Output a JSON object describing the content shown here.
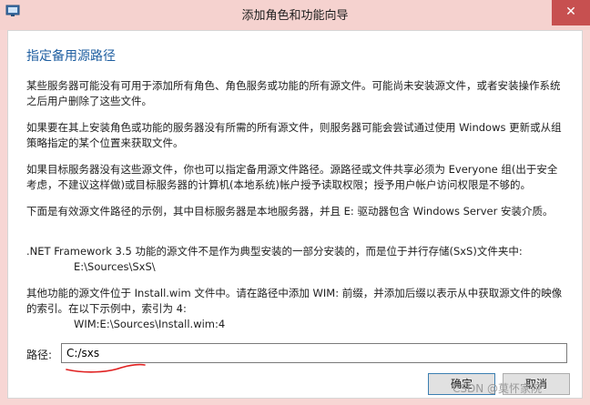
{
  "window": {
    "title": "添加角色和功能向导",
    "close_label": "✕"
  },
  "content": {
    "heading": "指定备用源路径",
    "paragraphs": [
      "某些服务器可能没有可用于添加所有角色、角色服务或功能的所有源文件。可能尚未安装源文件，或者安装操作系统之后用户删除了这些文件。",
      "如果要在其上安装角色或功能的服务器没有所需的所有源文件，则服务器可能会尝试通过使用 Windows 更新或从组策略指定的某个位置来获取文件。",
      "如果目标服务器没有这些源文件，你也可以指定备用源文件路径。源路径或文件共享必须为 Everyone 组(出于安全考虑，不建议这样做)或目标服务器的计算机(本地系统)帐户授予读取权限；授予用户帐户访问权限是不够的。",
      "下面是有效源文件路径的示例，其中目标服务器是本地服务器，并且 E: 驱动器包含 Windows Server 安装介质。"
    ],
    "netfx_text": ".NET Framework 3.5 功能的源文件不是作为典型安装的一部分安装的，而是位于并行存储(SxS)文件夹中:",
    "netfx_path": "E:\\Sources\\SxS\\",
    "wim_text": "其他功能的源文件位于 Install.wim 文件中。请在路径中添加 WIM: 前缀，并添加后缀以表示从中获取源文件的映像的索引。在以下示例中，索引为 4:",
    "wim_path": "WIM:E:\\Sources\\Install.wim:4"
  },
  "path_field": {
    "label": "路径:",
    "value": "C:/sxs"
  },
  "buttons": {
    "ok": "确定",
    "cancel": "取消"
  },
  "watermark": "CSDN @莫怀家院",
  "colors": {
    "heading": "#1f5fa1",
    "titlebar": "#f5d2cf",
    "close": "#c75050",
    "annotation": "#e02020"
  }
}
